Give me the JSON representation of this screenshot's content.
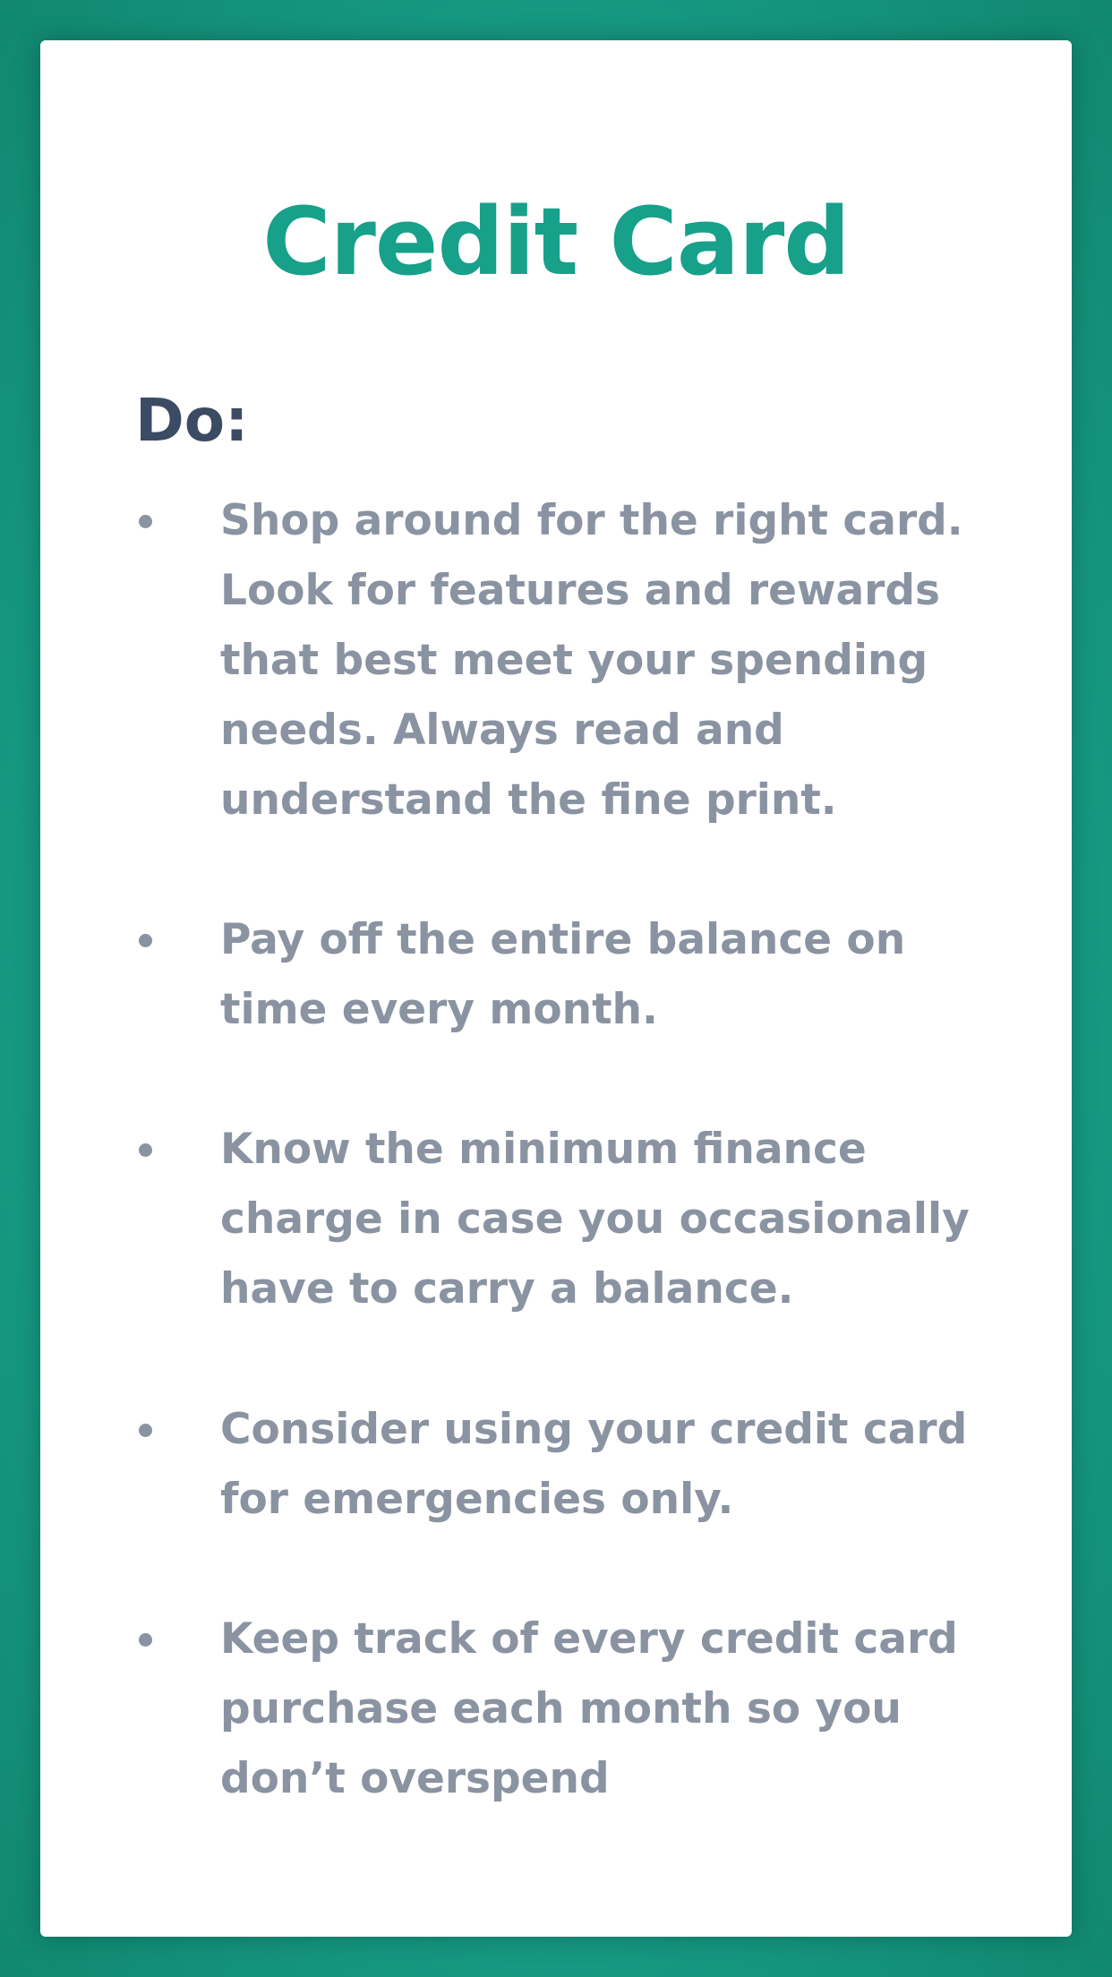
{
  "card": {
    "title": "Credit Card",
    "section_heading": "Do:",
    "items": [
      {
        "text": "Shop around for the right card. Look for features and rewards that best meet your spending needs. Always read and understand the fine print."
      },
      {
        "text": "Pay off the entire balance on time every month."
      },
      {
        "text": "Know the minimum finance charge in case you occasionally have to carry a balance."
      },
      {
        "text": "Consider using your credit card for emergencies only."
      },
      {
        "text": "Keep track of every credit card purchase each month so you don’t overspend"
      }
    ]
  },
  "colors": {
    "background": "#17a08a",
    "accent": "#17a08a",
    "heading": "#3b4b63",
    "body_text": "#8a93a1"
  }
}
